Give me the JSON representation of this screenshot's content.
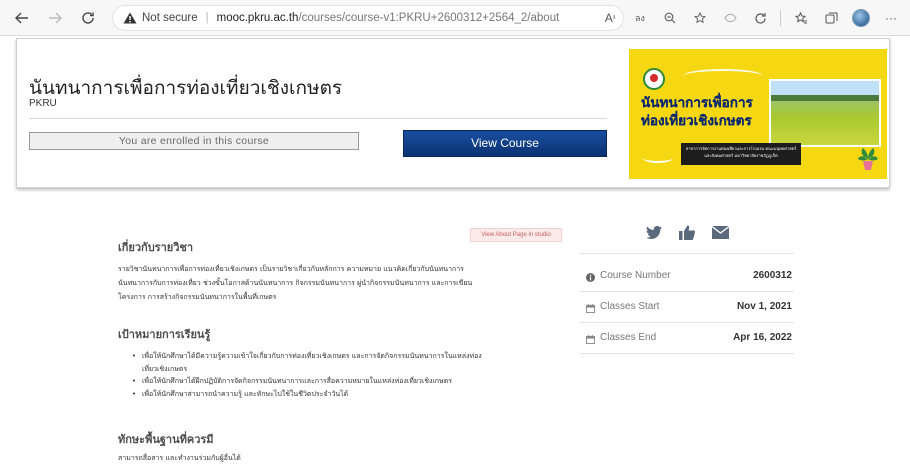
{
  "browser": {
    "not_secure": "Not secure",
    "url_host": "mooc.pkru.ac.th",
    "url_path": "/courses/course-v1:PKRU+2600312+2564_2/about",
    "icons": [
      "back-icon",
      "forward-icon",
      "reload-icon",
      "warning-icon",
      "read-aloud-icon",
      "translate-icon",
      "zoom-icon",
      "favorite-add-icon",
      "browser-essentials-icon",
      "refresh-extension-icon",
      "favorites-icon",
      "collections-icon",
      "profile-avatar",
      "more-icon"
    ],
    "zoom_glyph": "A",
    "translate_glyph": "ลง",
    "more_glyph": "···"
  },
  "hero": {
    "title": "นันทนาการเพื่อการท่องเที่ยวเชิงเกษตร",
    "org": "PKRU",
    "enrolled_text": "You are enrolled in this course",
    "view_course_label": "View Course",
    "image": {
      "line1": "นันทนาการเพื่อการ",
      "line2": "ท่องเที่ยวเชิงเกษตร",
      "banner": "สาขาการจัดการงานท่องเที่ยวและการโรงแรม คณะมนุษยศาสตร์และสังคมศาสตร์ มหาวิทยาลัยราชภัฏภูเก็ต",
      "background_color": "#f5d712"
    }
  },
  "about": {
    "studio_label": "View About Page in studio",
    "heading": "เกี่ยวกับรายวิชา",
    "description_lines": [
      "รายวิชานันทนาการเพื่อการท่องเที่ยวเชิงเกษตร เป็นรายวิชาเกี่ยวกับหลักการ ความหมาย แนวคิดเกี่ยวกับนันทนาการ",
      "นันทนาการกับการท่องเที่ยว ช่วงขั้นโอกาสด้านนันทนาการ กิจกรรมนันทนาการ ผู่นำกิจกรรมนันทนาการ และการเขียน",
      "โครงการ การสร้างกิจกรรมนันทนาการในพื้นที่เกษตร"
    ],
    "goals_heading": "เป้าหมายการเรียนรู้",
    "goals": [
      [
        "เพื่อให้นักศึกษาได้มีความรู้ความเข้าใจเกี่ยวกับการท่องเที่ยวเชิงเกษตร และการจัดกิจกรรมนันทนาการในแหล่งท่อง",
        "เที่ยวเชิงเกษตร"
      ],
      [
        "เพื่อให้นักศึกษาได้ฝึกปฏิบัติการจัดกิจกรรมนันทนาการและการสื่อความหมายในแหล่งท่องเที่ยวเชิงเกษตร"
      ],
      [
        "เพื่อให้นักศึกษาสามารถนำความรู้ และทักษะไปใช้ในชีวิตประจำวันได้"
      ]
    ],
    "skills_heading": "ทักษะพื้นฐานที่ควรมี",
    "skills_text": "สามารถสื่อสาร และทำงานร่วมกับผู้อื่นได้"
  },
  "sidebar": {
    "share_icons": [
      "twitter-icon",
      "like-icon",
      "email-icon"
    ],
    "rows": [
      {
        "label": "Course Number",
        "value": "2600312",
        "icon": "info-icon"
      },
      {
        "label": "Classes Start",
        "value": "Nov 1, 2021",
        "icon": "calendar-icon"
      },
      {
        "label": "Classes End",
        "value": "Apr 16, 2022",
        "icon": "calendar-icon"
      }
    ]
  },
  "colors": {
    "primary_button": "#0a3272",
    "studio_button_bg": "#fbeaea",
    "studio_button_text": "#c46060"
  }
}
